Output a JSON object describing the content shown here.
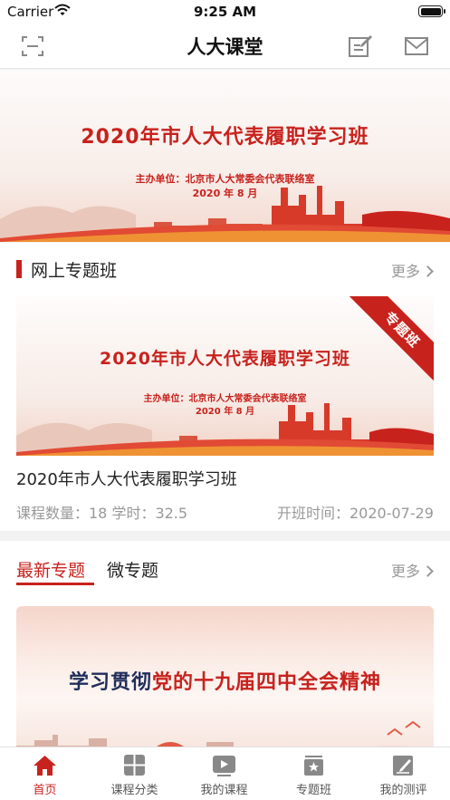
{
  "status_bar": {
    "carrier": "Carrier",
    "time": "9:25 AM"
  },
  "header": {
    "title": "人大课堂",
    "icons": [
      "scan-icon",
      "edit-icon",
      "mail-icon"
    ]
  },
  "banner": {
    "title": "2020年市人大代表履职学习班",
    "organizer": "主办单位：北京市人大常委会代表联络室",
    "date": "2020 年 8 月"
  },
  "online_section": {
    "title": "网上专题班",
    "more_label": "更多",
    "course": {
      "image_title": "2020年市人大代表履职学习班",
      "image_organizer": "主办单位：北京市人大常委会代表联络室",
      "image_date": "2020 年 8 月",
      "ribbon": "专题班",
      "name": "2020年市人大代表履职学习班",
      "meta": "课程数量：18 学时：32.5",
      "open_time": "开班时间：2020-07-29"
    }
  },
  "topics_section": {
    "tabs": [
      {
        "label": "最新专题",
        "active": true
      },
      {
        "label": "微专题",
        "active": false
      }
    ],
    "more_label": "更多",
    "card": {
      "title_part1": "学习贯彻",
      "title_part2": "党的十九届四中全会精神"
    }
  },
  "tab_bar": {
    "items": [
      {
        "label": "首页",
        "icon": "home-icon",
        "active": true
      },
      {
        "label": "课程分类",
        "icon": "category-grid-icon",
        "active": false
      },
      {
        "label": "我的课程",
        "icon": "play-video-icon",
        "active": false
      },
      {
        "label": "专题班",
        "icon": "star-board-icon",
        "active": false
      },
      {
        "label": "我的测评",
        "icon": "assessment-edit-icon",
        "active": false
      }
    ]
  },
  "colors": {
    "accent": "#c8221d",
    "muted": "#999999",
    "background": "#f2f2f2"
  }
}
